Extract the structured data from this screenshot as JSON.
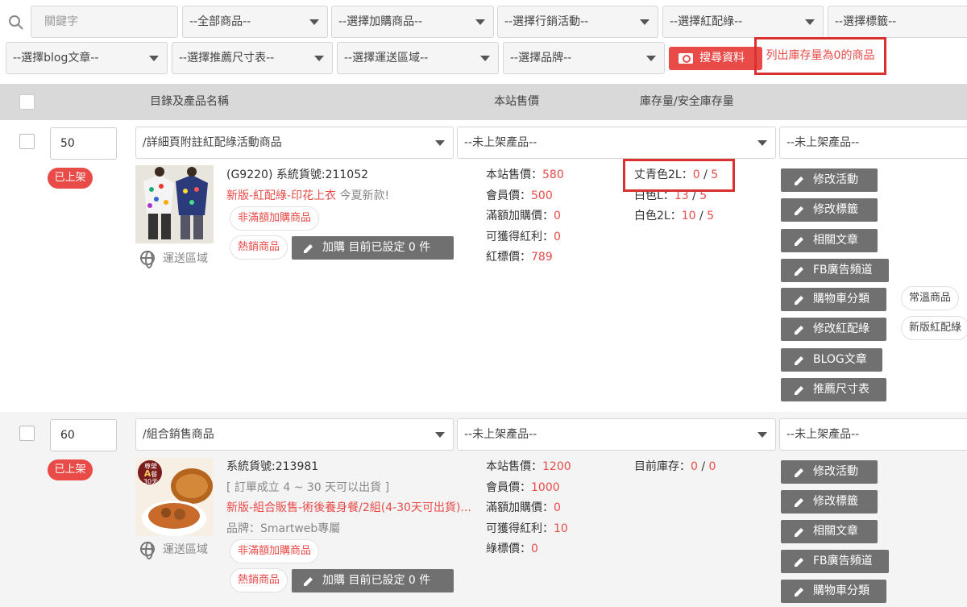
{
  "filters": {
    "keyword_placeholder": "關鍵字",
    "all_products": "--全部商品--",
    "addon_products": "--選擇加購商品--",
    "marketing": "--選擇行銷活動--",
    "red_green": "--選擇紅配綠--",
    "tags": "--選擇標籤--",
    "blog": "--選擇blog文章--",
    "size_chart": "--選擇推薦尺寸表--",
    "shipping_region": "--選擇運送區域--",
    "brand": "--選擇品牌--",
    "search_button": "搜尋資料",
    "zero_stock_link": "列出庫存量為0的商品"
  },
  "table_header": {
    "col_name": "目錄及產品名稱",
    "col_price": "本站售價",
    "col_stock": "庫存量/安全庫存量"
  },
  "rows": [
    {
      "sort": "50",
      "category": "/詳細頁附註紅配綠活動商品",
      "status_select_1": "--未上架產品--",
      "status_select_2": "--未上架產品--",
      "badge": "已上架",
      "ship": "運送區域",
      "line1": "(G9220) 系統貨號:211052",
      "line2_red": "新版-紅配綠-印花上衣",
      "line2_grey": " 今夏新款!",
      "pill_nonfull": "非滿額加購商品",
      "pill_hot": "熱銷商品",
      "addon_btn": "加購 目前已設定 0 件",
      "prices": [
        {
          "label": "本站售價：",
          "value": "580"
        },
        {
          "label": "會員價：",
          "value": "500"
        },
        {
          "label": "滿額加購價：",
          "value": "0"
        },
        {
          "label": "可獲得紅利：",
          "value": "0"
        },
        {
          "label": "紅標價：",
          "value": "789"
        }
      ],
      "stock": [
        {
          "label": "丈青色2L：",
          "qty": "0",
          "sep": " / ",
          "safe": "5"
        },
        {
          "label": "白色L：",
          "qty": "13",
          "sep": " / ",
          "safe": "5"
        },
        {
          "label": "白色2L：",
          "qty": "10",
          "sep": " / ",
          "safe": "5"
        }
      ],
      "actions": [
        "修改活動",
        "修改標籤",
        "相關文章",
        "FB廣告頻道",
        "購物車分類",
        "修改紅配綠",
        "BLOG文章",
        "推薦尺寸表"
      ],
      "tag_pills": [
        "常溫商品",
        "新版紅配綠"
      ]
    },
    {
      "sort": "60",
      "category": "/組合銷售商品",
      "status_select_1": "--未上架產品--",
      "status_select_2": "--未上架產品--",
      "badge": "已上架",
      "ship": "運送區域",
      "line1": "系統貨號:213981",
      "line2": "[ 訂單成立 4 ~ 30 天可以出貨 ]",
      "line3": "新版-組合販售-術後養身餐/2組(4-30天可出貨)...",
      "line4": "品牌：Smartweb專屬",
      "pill_nonfull": "非滿額加購商品",
      "pill_hot": "熱銷商品",
      "addon_btn": "加購 目前已設定 0 件",
      "prices": [
        {
          "label": "本站售價：",
          "value": "1200"
        },
        {
          "label": "會員價：",
          "value": "1000"
        },
        {
          "label": "滿額加購價：",
          "value": "0"
        },
        {
          "label": "可獲得紅利：",
          "value": "10"
        },
        {
          "label": "綠標價：",
          "value": "0"
        }
      ],
      "stock_label": "目前庫存：",
      "stock_qty": "0",
      "stock_sep": " / ",
      "stock_safe": "0",
      "actions": [
        "修改活動",
        "修改標籤",
        "相關文章",
        "FB廣告頻道",
        "購物車分類"
      ],
      "thumb_badge_1": "尊榮",
      "thumb_badge_2": "A",
      "thumb_badge_3": "餐",
      "thumb_badge_4": "30天"
    }
  ],
  "colors": {
    "accent": "#e84b48",
    "button_grey": "#707070",
    "header_grey": "#d9d9d9",
    "highlight_border": "#d9312f"
  }
}
